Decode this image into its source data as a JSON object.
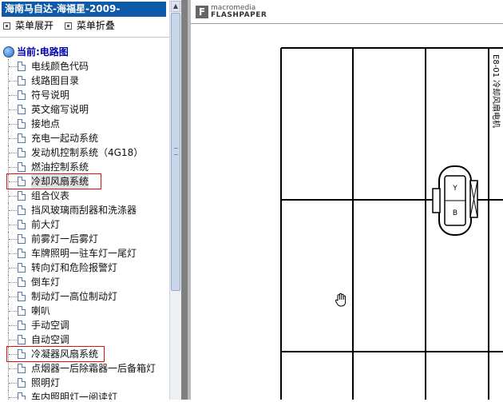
{
  "window_title": "海南马自达-海福星-2009-",
  "menu": {
    "expand": "菜单展开",
    "collapse": "菜单折叠"
  },
  "tree_root": "当前:电路图",
  "tree_items": [
    "电线颜色代码",
    "线路图目录",
    "符号说明",
    "英文缩写说明",
    "接地点",
    "充电一起动系统",
    "发动机控制系统（4G18）",
    "燃油控制系统",
    "冷却风扇系统",
    "组合仪表",
    "挡风玻璃雨刮器和洗涤器",
    "前大灯",
    "前雾灯一后雾灯",
    "车牌照明一驻车灯一尾灯",
    "转向灯和危险报警灯",
    "倒车灯",
    "制动灯一高位制动灯",
    "喇叭",
    "手动空调",
    "自动空调",
    "冷凝器风扇系统",
    "点烟器一后除霜器一后备箱灯",
    "照明灯",
    "车内照明灯一阅读灯"
  ],
  "selected_index": 8,
  "highlight_indices": [
    8,
    20
  ],
  "viewer": {
    "logo_top": "macromedia",
    "logo_bottom": "FLASHPAPER",
    "logo_mark": "F",
    "diagram_code": "E8-01",
    "diagram_title": "冷却风扇电机",
    "pin_y": "Y",
    "pin_b": "B"
  },
  "colors": {
    "title_bg": "#0f5aa8",
    "highlight_border": "#e01010",
    "root_text": "#0000aa"
  }
}
